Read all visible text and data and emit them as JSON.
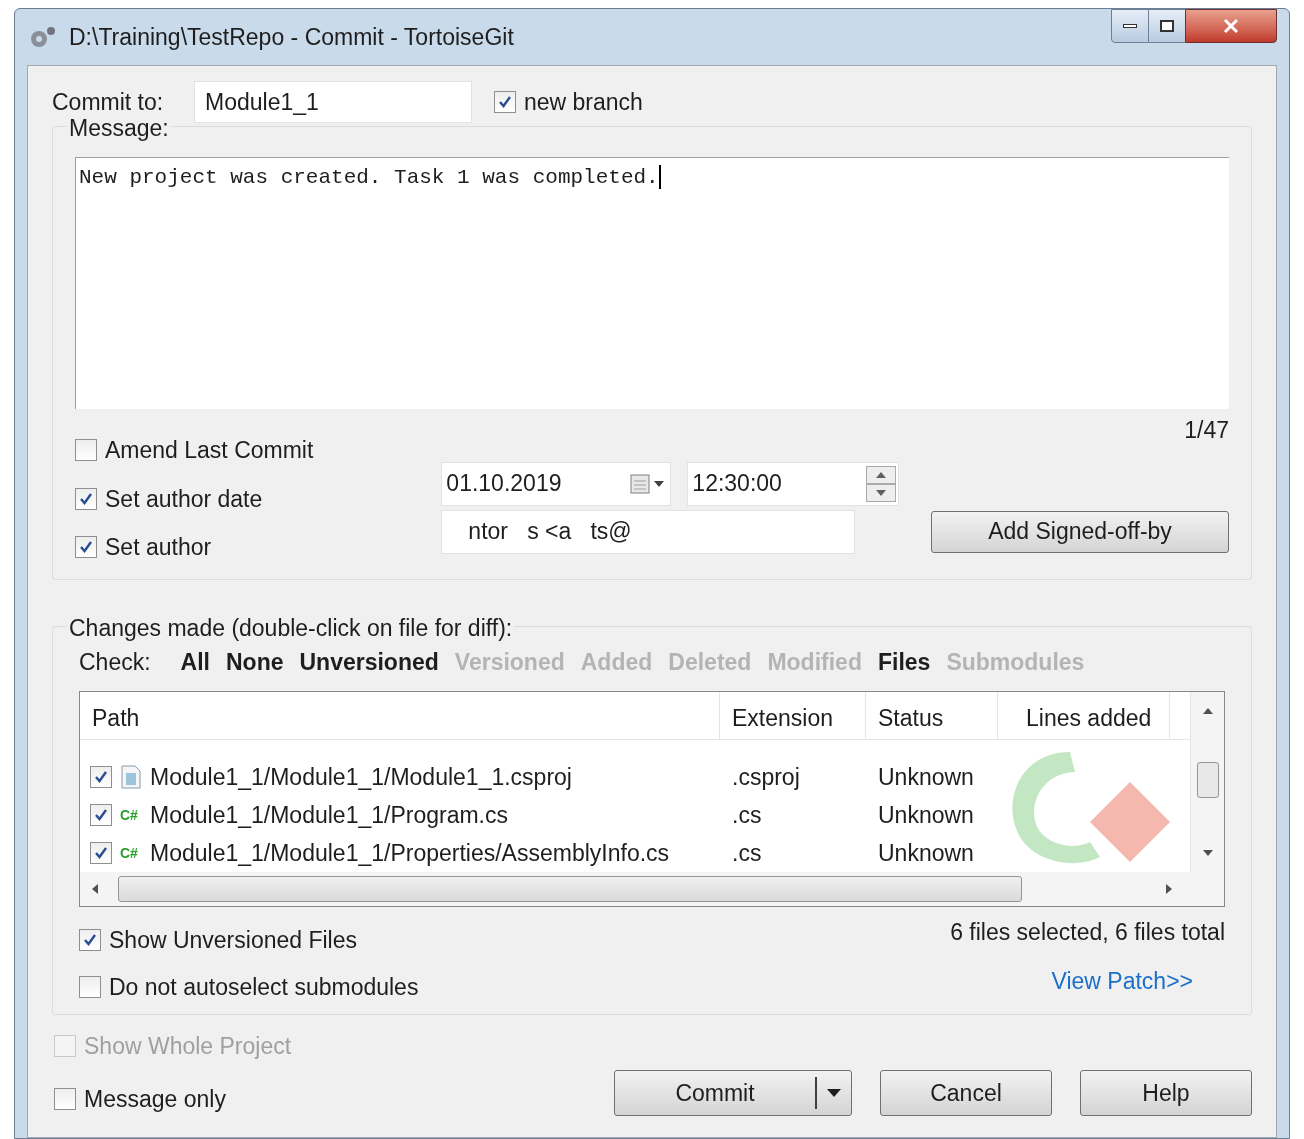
{
  "window": {
    "title": "D:\\Training\\TestRepo - Commit - TortoiseGit"
  },
  "commit_to": {
    "label": "Commit to:",
    "value": "Module1_1"
  },
  "new_branch": {
    "label": "new branch",
    "checked": true
  },
  "message": {
    "label": "Message:",
    "value": "New project was created. Task 1 was completed.",
    "counter": "1/47"
  },
  "options": [
    {
      "label": "Amend Last Commit",
      "checked": false
    },
    {
      "label": "Set author date",
      "checked": true
    },
    {
      "label": "Set author",
      "checked": true
    }
  ],
  "author_date": {
    "date": "01.10.2019",
    "time": "12:30:00"
  },
  "author": {
    "value": "ntor   s <a   ts@"
  },
  "signed_off_button": "Add Signed-off-by",
  "changes": {
    "label": "Changes made (double-click on file for diff):",
    "check_label": "Check:",
    "filters": [
      {
        "label": "All",
        "disabled": false
      },
      {
        "label": "None",
        "disabled": false
      },
      {
        "label": "Unversioned",
        "disabled": false
      },
      {
        "label": "Versioned",
        "disabled": true
      },
      {
        "label": "Added",
        "disabled": true
      },
      {
        "label": "Deleted",
        "disabled": true
      },
      {
        "label": "Modified",
        "disabled": true
      },
      {
        "label": "Files",
        "disabled": false
      },
      {
        "label": "Submodules",
        "disabled": true
      }
    ],
    "columns": [
      "Path",
      "Extension",
      "Status",
      "Lines added"
    ],
    "rows": [
      {
        "kind": "file",
        "path": "Module1_1/Module1_1/Module1_1.csproj",
        "extension": ".csproj",
        "status": "Unknown",
        "checked": true
      },
      {
        "kind": "csharp",
        "icon_text": "C#",
        "path": "Module1_1/Module1_1/Program.cs",
        "extension": ".cs",
        "status": "Unknown",
        "checked": true
      },
      {
        "kind": "csharp",
        "icon_text": "C#",
        "path": "Module1_1/Module1_1/Properties/AssemblyInfo.cs",
        "extension": ".cs",
        "status": "Unknown",
        "checked": true
      }
    ],
    "summary": "6 files selected, 6 files total",
    "show_unversioned": {
      "label": "Show Unversioned Files",
      "checked": true
    },
    "no_autoselect": {
      "label": "Do not autoselect submodules",
      "checked": false
    },
    "view_patch": "View Patch>>"
  },
  "bottom_options": [
    {
      "label": "Show Whole Project",
      "checked": false,
      "disabled": true
    },
    {
      "label": "Message only",
      "checked": false,
      "disabled": false
    }
  ],
  "buttons": [
    {
      "kind": "split",
      "label": "Commit"
    },
    {
      "kind": "plain",
      "label": "Cancel"
    },
    {
      "kind": "plain",
      "label": "Help"
    }
  ]
}
